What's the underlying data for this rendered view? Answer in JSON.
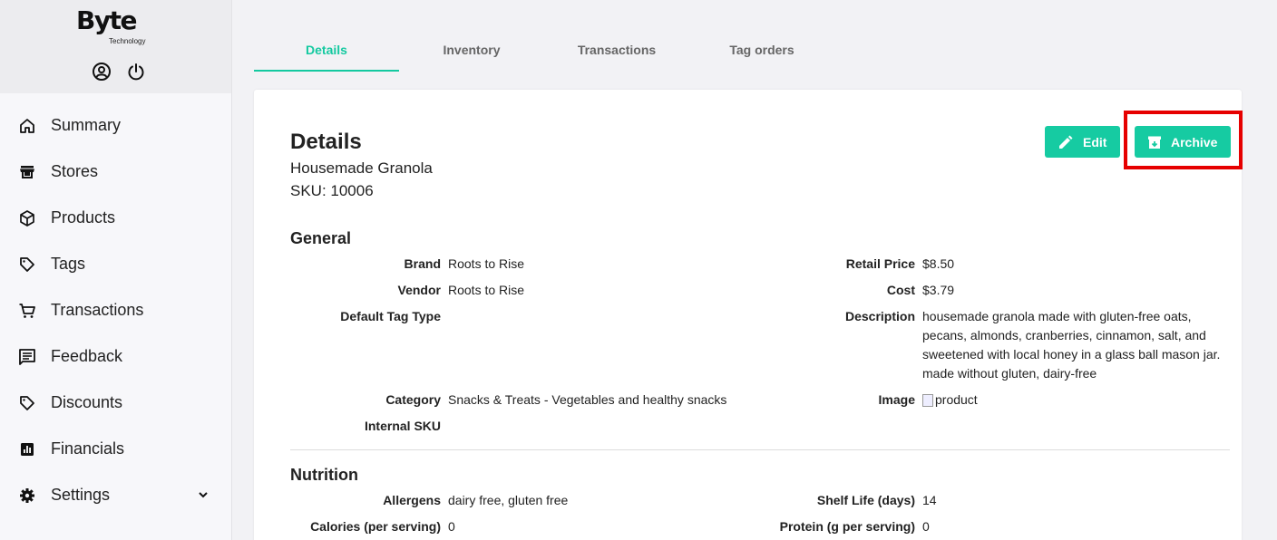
{
  "brand": {
    "name": "Byte",
    "subtitle": "Technology"
  },
  "header_icons": [
    "account-circle-icon",
    "power-icon"
  ],
  "sidebar": {
    "items": [
      {
        "label": "Summary",
        "icon": "home-icon"
      },
      {
        "label": "Stores",
        "icon": "store-icon"
      },
      {
        "label": "Products",
        "icon": "box-icon"
      },
      {
        "label": "Tags",
        "icon": "tag-icon"
      },
      {
        "label": "Transactions",
        "icon": "cart-icon"
      },
      {
        "label": "Feedback",
        "icon": "feedback-icon"
      },
      {
        "label": "Discounts",
        "icon": "discount-tag-icon"
      },
      {
        "label": "Financials",
        "icon": "chart-icon"
      },
      {
        "label": "Settings",
        "icon": "gear-icon",
        "expandable": true
      }
    ]
  },
  "tabs": [
    {
      "label": "Details",
      "active": true
    },
    {
      "label": "Inventory",
      "active": false
    },
    {
      "label": "Transactions",
      "active": false
    },
    {
      "label": "Tag orders",
      "active": false
    }
  ],
  "card": {
    "title": "Details",
    "product_name": "Housemade Granola",
    "sku_line": "SKU: 10006",
    "edit_label": "Edit",
    "archive_label": "Archive"
  },
  "general": {
    "title": "General",
    "brand_label": "Brand",
    "brand_value": "Roots to Rise",
    "vendor_label": "Vendor",
    "vendor_value": "Roots to Rise",
    "tagtype_label": "Default Tag Type",
    "tagtype_value": "",
    "category_label": "Category",
    "category_value": "Snacks & Treats - Vegetables and healthy snacks",
    "internal_sku_label": "Internal SKU",
    "internal_sku_value": "",
    "retail_label": "Retail Price",
    "retail_value": "$8.50",
    "cost_label": "Cost",
    "cost_value": "$3.79",
    "description_label": "Description",
    "description_value": "housemade granola made with gluten-free oats, pecans, almonds, cranberries, cinnamon, salt, and sweetened with local honey in a glass ball mason jar. made without gluten, dairy-free",
    "image_label": "Image",
    "image_alt": "product"
  },
  "nutrition": {
    "title": "Nutrition",
    "allergens_label": "Allergens",
    "allergens_value": "dairy free, gluten free",
    "calories_label": "Calories (per serving)",
    "calories_value": "0",
    "shelf_label": "Shelf Life (days)",
    "shelf_value": "14",
    "protein_label": "Protein (g per serving)",
    "protein_value": "0"
  },
  "colors": {
    "accent": "#16cba2",
    "highlight": "#e60000"
  }
}
